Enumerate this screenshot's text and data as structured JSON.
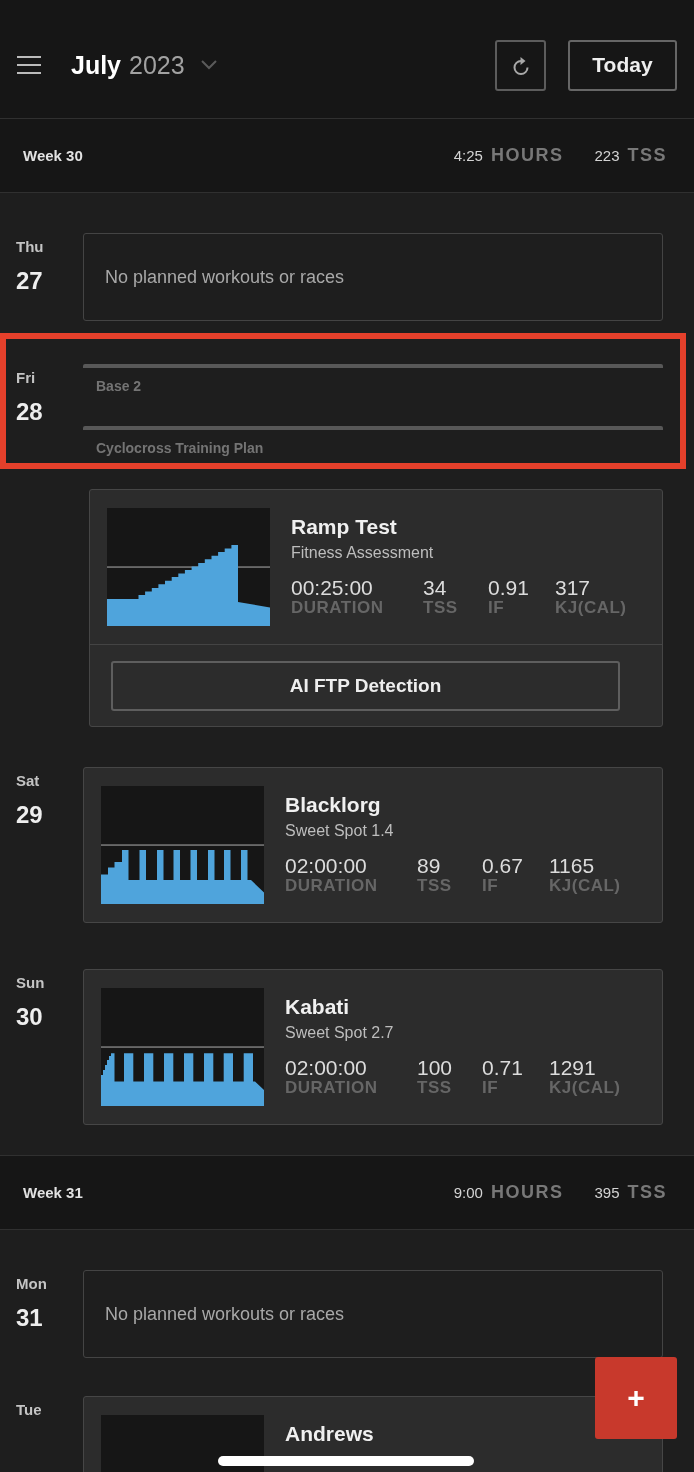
{
  "header": {
    "month": "July",
    "year": "2023",
    "today_button": "Today"
  },
  "weeks": [
    {
      "label": "Week 30",
      "hours": "4:25",
      "hours_unit": "HOURS",
      "tss": "223",
      "tss_unit": "TSS",
      "days": [
        {
          "weekday": "Thu",
          "date": "27",
          "highlighted": false,
          "empty_text": "No planned workouts or races"
        },
        {
          "weekday": "Fri",
          "date": "28",
          "highlighted": true,
          "plans": [
            {
              "label": "Base 2"
            },
            {
              "label": "Cyclocross Training Plan"
            }
          ],
          "workouts": [
            {
              "kind": "ramp",
              "title": "Ramp Test",
              "subtitle": "Fitness Assessment",
              "stats": [
                {
                  "value": "00:25:00",
                  "label": "DURATION"
                },
                {
                  "value": "34",
                  "label": "TSS"
                },
                {
                  "value": "0.91",
                  "label": "IF"
                },
                {
                  "value": "317",
                  "label": "KJ(CAL)"
                }
              ],
              "action": "AI FTP Detection"
            }
          ]
        },
        {
          "weekday": "Sat",
          "date": "29",
          "highlighted": false,
          "workouts": [
            {
              "kind": "intervals",
              "title": "Blacklorg",
              "subtitle": "Sweet Spot 1.4",
              "stats": [
                {
                  "value": "02:00:00",
                  "label": "DURATION"
                },
                {
                  "value": "89",
                  "label": "TSS"
                },
                {
                  "value": "0.67",
                  "label": "IF"
                },
                {
                  "value": "1165",
                  "label": "KJ(CAL)"
                }
              ]
            }
          ]
        },
        {
          "weekday": "Sun",
          "date": "30",
          "highlighted": false,
          "workouts": [
            {
              "kind": "intervals",
              "title": "Kabati",
              "subtitle": "Sweet Spot 2.7",
              "stats": [
                {
                  "value": "02:00:00",
                  "label": "DURATION"
                },
                {
                  "value": "100",
                  "label": "TSS"
                },
                {
                  "value": "0.71",
                  "label": "IF"
                },
                {
                  "value": "1291",
                  "label": "KJ(CAL)"
                }
              ]
            }
          ]
        }
      ]
    },
    {
      "label": "Week 31",
      "hours": "9:00",
      "hours_unit": "HOURS",
      "tss": "395",
      "tss_unit": "TSS",
      "days": [
        {
          "weekday": "Mon",
          "date": "31",
          "highlighted": false,
          "empty_text": "No planned workouts or races"
        },
        {
          "weekday": "Tue",
          "highlighted": false,
          "workouts": [
            {
              "title": "Andrews"
            }
          ]
        }
      ]
    }
  ],
  "add_button": "+"
}
